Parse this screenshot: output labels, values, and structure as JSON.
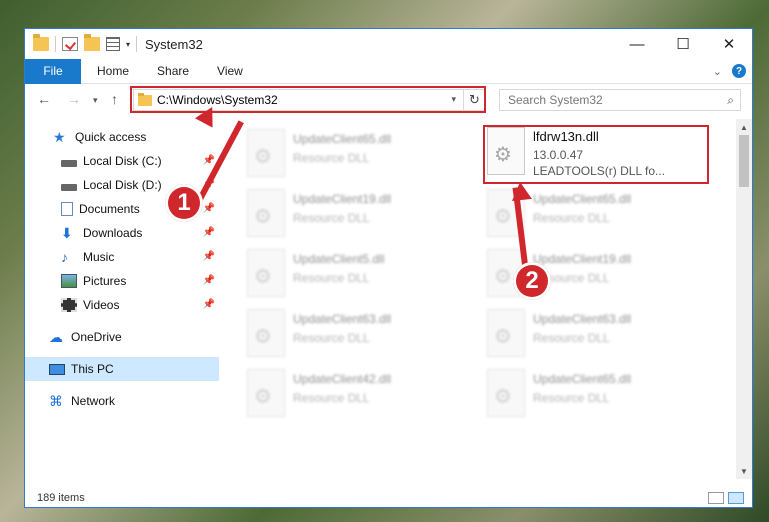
{
  "window": {
    "title": "System32",
    "controls": {
      "minimize": "—",
      "maximize": "☐",
      "close": "✕"
    }
  },
  "ribbon": {
    "tabs": [
      "File",
      "Home",
      "Share",
      "View"
    ]
  },
  "address": {
    "path": "C:\\Windows\\System32",
    "search_placeholder": "Search System32"
  },
  "sidebar": {
    "quick_access": "Quick access",
    "items": [
      {
        "label": "Local Disk (C:)",
        "icon": "drive-icon",
        "pinned": true
      },
      {
        "label": "Local Disk (D:)",
        "icon": "drive-icon",
        "pinned": true
      },
      {
        "label": "Documents",
        "icon": "documents-icon",
        "pinned": true
      },
      {
        "label": "Downloads",
        "icon": "downloads-icon",
        "pinned": true
      },
      {
        "label": "Music",
        "icon": "music-icon",
        "pinned": true
      },
      {
        "label": "Pictures",
        "icon": "pictures-icon",
        "pinned": true
      },
      {
        "label": "Videos",
        "icon": "videos-icon",
        "pinned": true
      }
    ],
    "onedrive": "OneDrive",
    "this_pc": "This PC",
    "network": "Network"
  },
  "files": {
    "left": [
      {
        "name": "UpdateClient65.dll",
        "desc": "Resource DLL"
      },
      {
        "name": "UpdateClient19.dll",
        "desc": "Resource DLL"
      },
      {
        "name": "UpdateClient5.dll",
        "desc": "Resource DLL"
      },
      {
        "name": "UpdateClient63.dll",
        "desc": "Resource DLL"
      },
      {
        "name": "UpdateClient42.dll",
        "desc": "Resource DLL"
      }
    ],
    "focus": {
      "name": "lfdrw13n.dll",
      "version": "13.0.0.47",
      "desc": "LEADTOOLS(r) DLL fo..."
    },
    "right": [
      {
        "name": "UpdateClient65.dll",
        "desc": "Resource DLL"
      },
      {
        "name": "UpdateClient19.dll",
        "desc": "Resource DLL"
      },
      {
        "name": "UpdateClient63.dll",
        "desc": "Resource DLL"
      },
      {
        "name": "UpdateClient65.dll",
        "desc": "Resource DLL"
      }
    ]
  },
  "status": {
    "items": "189 items"
  },
  "callouts": {
    "one": "1",
    "two": "2"
  },
  "colors": {
    "accent": "#1979ca",
    "highlight": "#d0272c",
    "selected": "#cde8ff"
  }
}
